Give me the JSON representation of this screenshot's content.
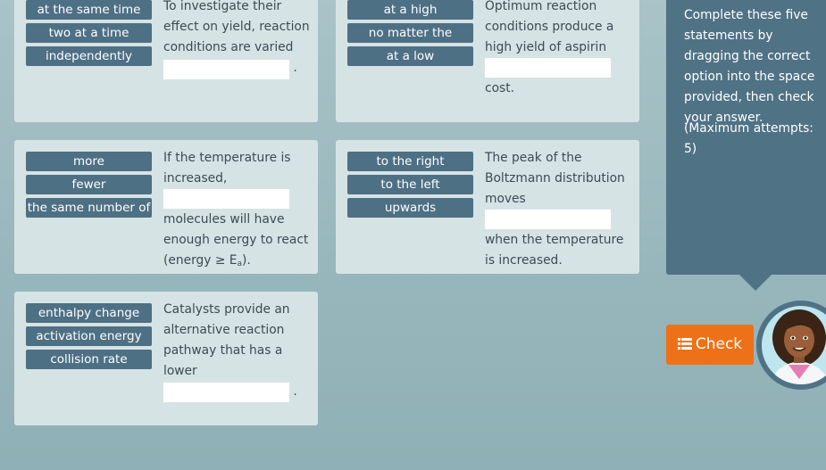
{
  "cards": [
    {
      "options": [
        "at the same time",
        "two at a time",
        "independently"
      ],
      "statement": {
        "before": "To investigate their effect on yield, reaction conditions are varied",
        "after": "."
      }
    },
    {
      "options": [
        "at a high",
        "no matter the",
        "at a low"
      ],
      "statement": {
        "before": "Optimum reaction conditions produce a high yield of aspirin",
        "after": "cost."
      }
    },
    {
      "options": [
        "more",
        "fewer",
        "the same number of"
      ],
      "statement": {
        "before": "If the temperature is increased,",
        "after": "molecules will have enough energy to react (energy ≥ E",
        "subscript": "a",
        "tail": ")."
      }
    },
    {
      "options": [
        "to the right",
        "to the left",
        "upwards"
      ],
      "statement": {
        "before": "The peak of the Boltzmann distribution moves",
        "after": "when the temperature is increased."
      }
    },
    {
      "options": [
        "enthalpy change",
        "activation energy",
        "collision rate"
      ],
      "statement": {
        "before": "Catalysts provide an alternative reaction pathway that has a lower",
        "after": "."
      }
    }
  ],
  "panel": {
    "instructions": "Complete these five statements by dragging the correct option into the space provided, then check your answer.",
    "attempts": "(Maximum attempts: 5)"
  },
  "check_button": {
    "label": "Check",
    "icon": "list-icon"
  },
  "colors": {
    "background": "#98b7bc",
    "card": "#d6e3e5",
    "option": "#4e7085",
    "panel": "#4f7285",
    "check": "#ee7118"
  }
}
